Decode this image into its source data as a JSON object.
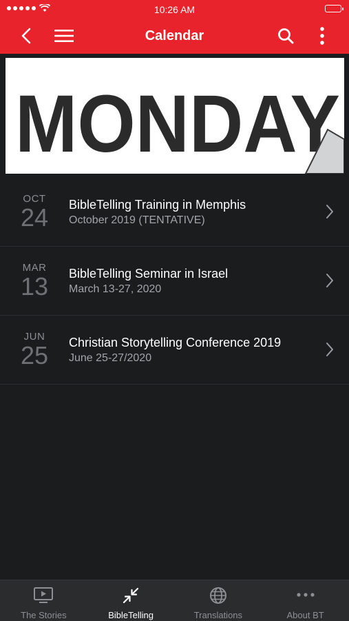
{
  "status_bar": {
    "time": "10:26 AM"
  },
  "header": {
    "title": "Calendar"
  },
  "banner": {
    "text": "MONDAY"
  },
  "events": [
    {
      "month": "OCT",
      "day": "24",
      "title": "BibleTelling Training in Memphis",
      "subtitle": "October 2019 (TENTATIVE)"
    },
    {
      "month": "MAR",
      "day": "13",
      "title": "BibleTelling Seminar in Israel",
      "subtitle": "March 13-27, 2020"
    },
    {
      "month": "JUN",
      "day": "25",
      "title": "Christian Storytelling Conference 2019",
      "subtitle": "June 25-27/2020"
    }
  ],
  "tabs": [
    {
      "label": "The Stories",
      "icon": "play-screen-icon"
    },
    {
      "label": "BibleTelling",
      "icon": "compress-arrows-icon",
      "active": true
    },
    {
      "label": "Translations",
      "icon": "globe-icon"
    },
    {
      "label": "About BT",
      "icon": "more-dots-icon"
    }
  ],
  "colors": {
    "accent": "#e8232b",
    "background": "#1b1c1e",
    "tabbar": "#2b2c2e"
  }
}
